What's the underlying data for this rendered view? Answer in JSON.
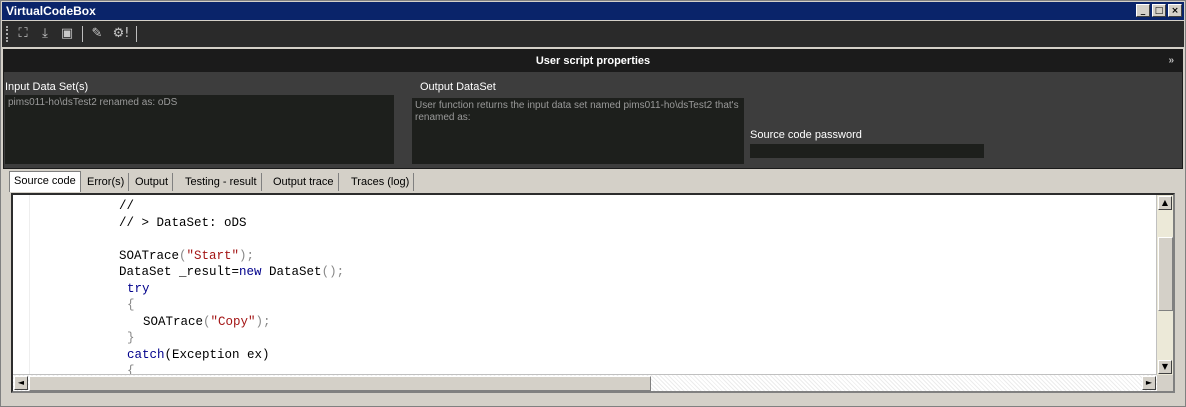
{
  "window": {
    "title": "VirtualCodeBox",
    "controls": [
      "_",
      "□",
      "×"
    ]
  },
  "toolbar": {
    "icons": [
      "run-icon",
      "download-icon",
      "lock-icon",
      "script-icon",
      "settings-icon"
    ],
    "glyphs": [
      "⛶",
      "⤓",
      "▣",
      "✎",
      "⚙!"
    ]
  },
  "props": {
    "header": "User script properties",
    "collapse_glyph": "»",
    "input_label": "Input Data Set(s)",
    "input_value": "pims011-ho\\dsTest2 renamed as: oDS",
    "output_label": "Output DataSet",
    "output_value": "User function returns the input data set named pims011-ho\\dsTest2 that's renamed as:",
    "password_label": "Source code password",
    "password_value": ""
  },
  "tabs": [
    "Source code",
    "Error(s)",
    "Output",
    "Testing - result",
    "Output trace",
    "Traces (log)"
  ],
  "active_tab": 0,
  "code": {
    "lines": [
      {
        "indent": 0,
        "parts": [
          {
            "t": "//",
            "c": ""
          }
        ]
      },
      {
        "indent": 0,
        "parts": [
          {
            "t": "// > DataSet: oDS",
            "c": ""
          }
        ]
      },
      {
        "indent": 0,
        "parts": [
          {
            "t": "",
            "c": ""
          }
        ]
      },
      {
        "indent": 0,
        "parts": [
          {
            "t": "SOATrace",
            "c": ""
          },
          {
            "t": "(",
            "c": "dim"
          },
          {
            "t": "\"Start\"",
            "c": "str"
          },
          {
            "t": ");",
            "c": "dim"
          }
        ]
      },
      {
        "indent": 0,
        "parts": [
          {
            "t": "DataSet _result=",
            "c": ""
          },
          {
            "t": "new",
            "c": "kw"
          },
          {
            "t": " DataSet",
            "c": ""
          },
          {
            "t": "();",
            "c": "dim"
          }
        ]
      },
      {
        "indent": 1,
        "parts": [
          {
            "t": "try",
            "c": "kw"
          }
        ]
      },
      {
        "indent": 1,
        "parts": [
          {
            "t": "{",
            "c": "dim"
          }
        ]
      },
      {
        "indent": 3,
        "parts": [
          {
            "t": "SOATrace",
            "c": ""
          },
          {
            "t": "(",
            "c": "dim"
          },
          {
            "t": "\"Copy\"",
            "c": "str"
          },
          {
            "t": ");",
            "c": "dim"
          }
        ]
      },
      {
        "indent": 1,
        "parts": [
          {
            "t": "}",
            "c": "dim"
          }
        ]
      },
      {
        "indent": 1,
        "parts": [
          {
            "t": "catch",
            "c": "kw"
          },
          {
            "t": "(Exception ex)",
            "c": ""
          }
        ]
      },
      {
        "indent": 1,
        "parts": [
          {
            "t": "{",
            "c": "dim"
          }
        ]
      }
    ]
  },
  "scroll": {
    "up": "▲",
    "down": "▼",
    "left": "◄",
    "right": "►"
  }
}
